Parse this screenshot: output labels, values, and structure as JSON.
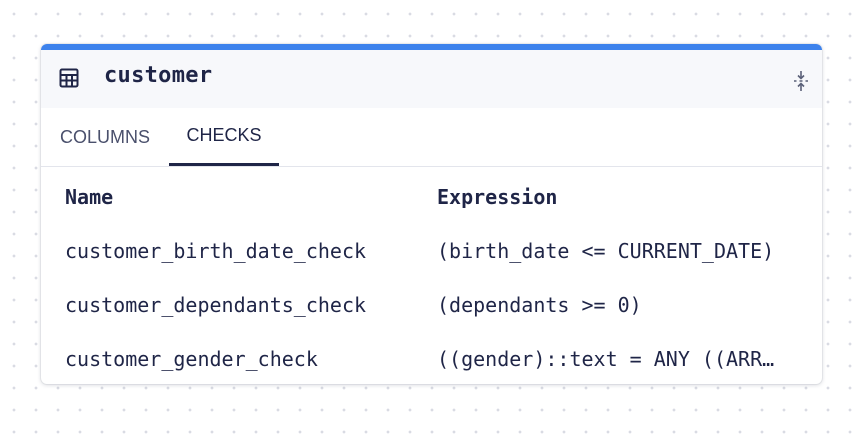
{
  "panel": {
    "title": "customer",
    "header_icon": "table-icon",
    "collapse_icon": "collapse-icon",
    "accent_color": "#3d82ec"
  },
  "tabs": [
    {
      "label": "COLUMNS",
      "active": false
    },
    {
      "label": "CHECKS",
      "active": true
    }
  ],
  "checks_table": {
    "headers": {
      "name": "Name",
      "expression": "Expression"
    },
    "rows": [
      {
        "name": "customer_birth_date_check",
        "expression": "(birth_date <= CURRENT_DATE)"
      },
      {
        "name": "customer_dependants_check",
        "expression": "(dependants >= 0)"
      },
      {
        "name": "customer_gender_check",
        "expression": "((gender)::text = ANY ((ARR…"
      }
    ]
  }
}
